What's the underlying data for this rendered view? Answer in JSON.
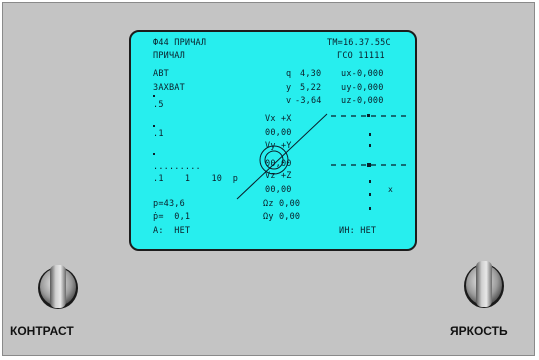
{
  "display": {
    "header_left": "Ф44 ПРИЧАЛ",
    "header_right": "ТМ=16.37.55С",
    "mode": "ПРИЧАЛ",
    "code": "ГСО 11111",
    "auto": "АВТ",
    "capture": "ЗАХВАТ",
    "q_label": "q",
    "q_value": "4,30",
    "ux_label": "ux-0,000",
    "y_label": "y",
    "y_value": "5,22",
    "uy_label": "uy-0,000",
    "v_label": "v",
    "v_value": "-3,64",
    "uz_label": "uz-0,000",
    "scale_5": ".5",
    "scale_1": ".1",
    "scale_axis": ".1    1    10  р",
    "dots": ".........",
    "vx_label": "Vx +X",
    "vx_value": "00,00",
    "vy_label": "Vy +Y",
    "vy_value": "00,00",
    "vz_label": "Vz +Z",
    "vz_value": "00,00",
    "p_value": "р=43,6",
    "pdot_value": "ṗ=  0,1",
    "a_status": "А:  НЕТ",
    "oz_value": "Ωz 0,00",
    "oy_value": "Ωy 0,00",
    "in_status": "ИН: НЕТ"
  },
  "controls": {
    "contrast_label": "КОНТРАСТ",
    "brightness_label": "ЯРКОСТЬ"
  },
  "colors": {
    "panel": "#c4c4c4",
    "screen": "#27eeee",
    "text": "#0a1f2a"
  }
}
